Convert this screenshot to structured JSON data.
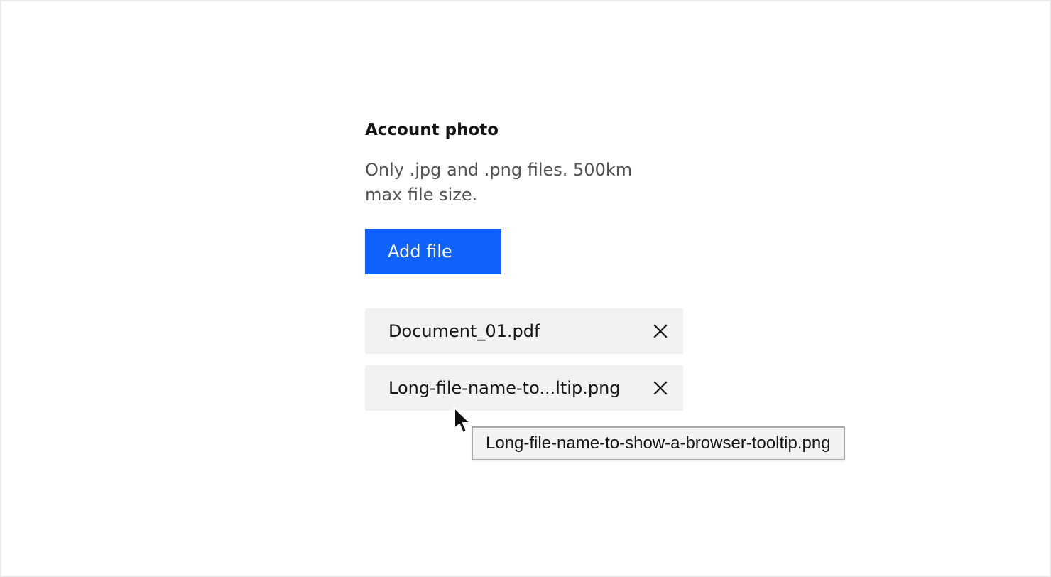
{
  "uploader": {
    "title": "Account photo",
    "description": "Only .jpg and .png files. 500km max file size.",
    "add_button_label": "Add file"
  },
  "files": [
    {
      "name": "Document_01.pdf",
      "remove_icon": "close-icon"
    },
    {
      "name": "Long-file-name-to...ltip.png",
      "remove_icon": "close-icon"
    }
  ],
  "tooltip": {
    "text": "Long-file-name-to-show-a-browser-tooltip.png"
  },
  "colors": {
    "primary": "#0f62fe",
    "text_primary": "#161616",
    "text_secondary": "#525252",
    "field_background": "#f2f2f2",
    "tooltip_border": "#a8a8a8"
  },
  "icons": {
    "close": "close-icon",
    "cursor": "pointer-cursor-icon"
  }
}
